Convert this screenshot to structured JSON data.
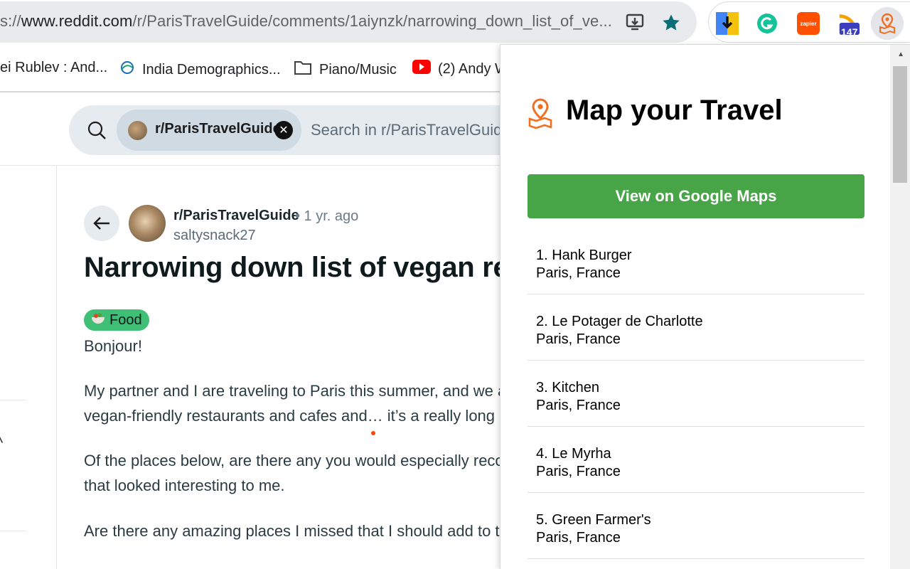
{
  "browser": {
    "url_prefix": "s://",
    "url_host": "www.reddit.com",
    "url_path": "/r/ParisTravelGuide/comments/1aiynzk/narrowing_down_list_of_ve...",
    "bookmarks": [
      {
        "label": "ei Rublev : And...",
        "icon": "none"
      },
      {
        "label": "India Demographics...",
        "icon": "globe-icon"
      },
      {
        "label": "Piano/Music",
        "icon": "folder-icon"
      },
      {
        "label": "(2) Andy W",
        "icon": "youtube-icon"
      }
    ],
    "extensions": {
      "badge_count": "147"
    },
    "colors": {
      "omnibox": "#e9eaee",
      "star": "#0b6e75"
    }
  },
  "reddit": {
    "search": {
      "chip_label": "r/ParisTravelGuide",
      "placeholder": "Search in r/ParisTravelGuide"
    },
    "post": {
      "subreddit": "r/ParisTravelGuide",
      "age": "• 1 yr. ago",
      "author": "saltysnack27",
      "title": "Narrowing down list of vegan resta",
      "flair": "Food",
      "paragraphs": [
        "Bonjour!",
        "My partner and I are traveling to Paris this summer, and we a",
        "vegan-friendly restaurants and cafes and… it’s a really long li",
        "Of the places below, are there any you would especially reco",
        "that looked interesting to me.",
        "Are there any amazing places I missed that I should add to th"
      ]
    }
  },
  "popup": {
    "title": "Map your Travel",
    "button_label": "View on Google Maps",
    "button_color": "#47a547",
    "places": [
      {
        "name": "1. Hank Burger",
        "location": "Paris, France"
      },
      {
        "name": "2. Le Potager de Charlotte",
        "location": "Paris, France"
      },
      {
        "name": "3. Kitchen",
        "location": "Paris, France"
      },
      {
        "name": "4. Le Myrha",
        "location": "Paris, France"
      },
      {
        "name": "5. Green Farmer's",
        "location": "Paris, France"
      }
    ]
  }
}
